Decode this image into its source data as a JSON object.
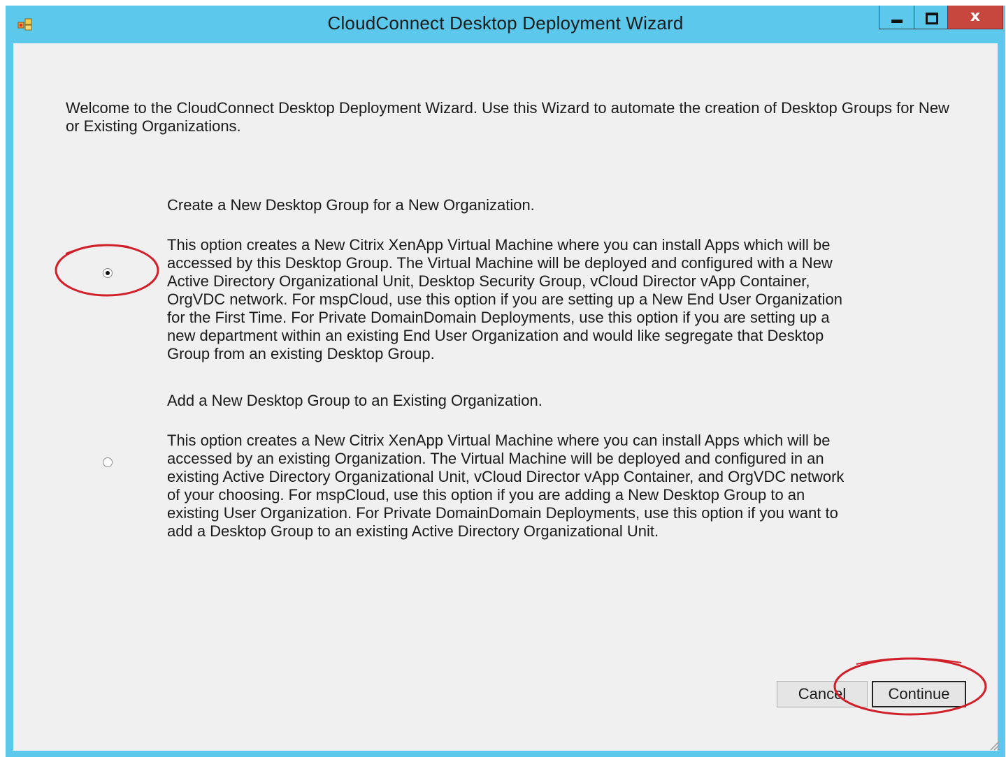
{
  "window": {
    "title": "CloudConnect Desktop Deployment Wizard",
    "controls": {
      "minimize": "minimize",
      "maximize": "maximize",
      "close": "x"
    }
  },
  "welcome_text": "Welcome to the CloudConnect Desktop Deployment Wizard.  Use this Wizard to automate the creation of Desktop Groups for New or Existing Organizations.",
  "options": [
    {
      "heading": "Create a New Desktop Group for a New Organization.",
      "description": "This option creates a New Citrix XenApp Virtual Machine where you can install Apps which will be accessed by this Desktop Group.  The Virtual Machine will be deployed and configured with a New Active Directory Organizational Unit, Desktop Security Group, vCloud Director vApp Container, OrgVDC network.  For mspCloud, use this option if you are setting up a New End User Organization for the First Time.  For Private DomainDomain Deployments, use this option if you are setting up a new department within an existing End User Organization and would like segregate that Desktop Group from an existing Desktop Group.",
      "selected": true
    },
    {
      "heading": "Add a New Desktop Group to an Existing Organization.",
      "description": "This option creates a New Citrix XenApp Virtual Machine where you can install Apps which will be accessed by an existing Organization.  The Virtual Machine will be deployed and configured in an existing Active Directory Organizational Unit, vCloud Director vApp Container, and OrgVDC network of your choosing.  For mspCloud, use this option if you are adding a New Desktop Group to an existing User Organization.  For Private DomainDomain Deployments, use this option if you want to add a Desktop Group to an existing Active Directory Organizational Unit.",
      "selected": false
    }
  ],
  "buttons": {
    "cancel": "Cancel",
    "continue": "Continue"
  },
  "colors": {
    "titlebar": "#5bc8ec",
    "client_bg": "#f0f0f0",
    "close_button": "#c7463d",
    "annotation_circle": "#d0202a"
  },
  "icons": [
    "app-icon",
    "minimize-icon",
    "maximize-icon",
    "close-icon",
    "resize-grip-icon"
  ]
}
